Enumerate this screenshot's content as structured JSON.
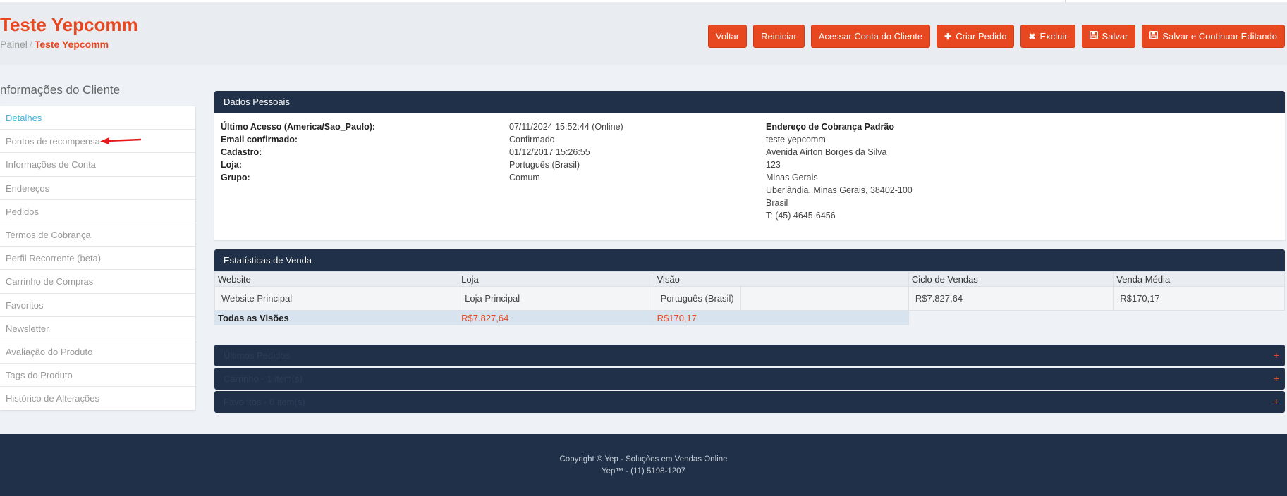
{
  "header": {
    "title": "Teste Yepcomm",
    "breadcrumb": {
      "home": "Painel",
      "separator": "/",
      "current": "Teste Yepcomm"
    },
    "buttons": {
      "back": "Voltar",
      "reset": "Reiniciar",
      "login_as": "Acessar Conta do Cliente",
      "create_order": "Criar Pedido",
      "delete": "Excluir",
      "save": "Salvar",
      "save_continue": "Salvar e Continuar Editando"
    }
  },
  "sidebar": {
    "title": "nformações do Cliente",
    "items": [
      {
        "label": "Detalhes",
        "active": true
      },
      {
        "label": "Pontos de recompensa"
      },
      {
        "label": "Informações de Conta"
      },
      {
        "label": "Endereços"
      },
      {
        "label": "Pedidos"
      },
      {
        "label": "Termos de Cobrança"
      },
      {
        "label": "Perfil Recorrente (beta)"
      },
      {
        "label": "Carrinho de Compras"
      },
      {
        "label": "Favoritos"
      },
      {
        "label": "Newsletter"
      },
      {
        "label": "Avaliação do Produto"
      },
      {
        "label": "Tags do Produto"
      },
      {
        "label": "Histórico de Alterações"
      }
    ]
  },
  "personal": {
    "title": "Dados Pessoais",
    "labels": [
      "Último Acesso (America/Sao_Paulo):",
      "Email confirmado:",
      "Cadastro:",
      "Loja:",
      "Grupo:"
    ],
    "values": [
      "07/11/2024 15:52:44 (Online)",
      "Confirmado",
      "01/12/2017 15:26:55",
      "Português (Brasil)",
      "Comum"
    ],
    "address": {
      "title": "Endereço de Cobrança Padrão",
      "lines": [
        "teste yepcomm",
        "Avenida Airton Borges da Silva",
        "123",
        "Minas Gerais",
        "Uberlândia, Minas Gerais, 38402-100",
        "Brasil",
        "T: (45) 4645-6456"
      ]
    }
  },
  "stats": {
    "title": "Estatísticas de Venda",
    "columns": [
      "Website",
      "Loja",
      "Visão",
      "Ciclo de Vendas",
      "Venda Média"
    ],
    "row": [
      "Website Principal",
      "Loja Principal",
      "Português (Brasil)",
      "",
      "R$7.827,64",
      "R$170,17"
    ],
    "total": {
      "label": "Todas as Visões",
      "lifetime": "R$7.827,64",
      "average": "R$170,17"
    }
  },
  "sections": [
    {
      "label": "Últimos Pedidos"
    },
    {
      "label": "Carrinho - 1 item(s)"
    },
    {
      "label": "Favoritos - 0 item(s)"
    }
  ],
  "footer": {
    "line1": "Copyright © Yep - Soluções em Vendas Online",
    "line2": "Yep™ - (11) 5198-1207"
  },
  "colors": {
    "accent": "#e8481f",
    "navy": "#1f3048",
    "link": "#3bb4e3"
  },
  "icons": {
    "create_order": "plus-icon",
    "delete": "x-icon",
    "save": "floppy-icon",
    "annotation": "red-arrow"
  }
}
